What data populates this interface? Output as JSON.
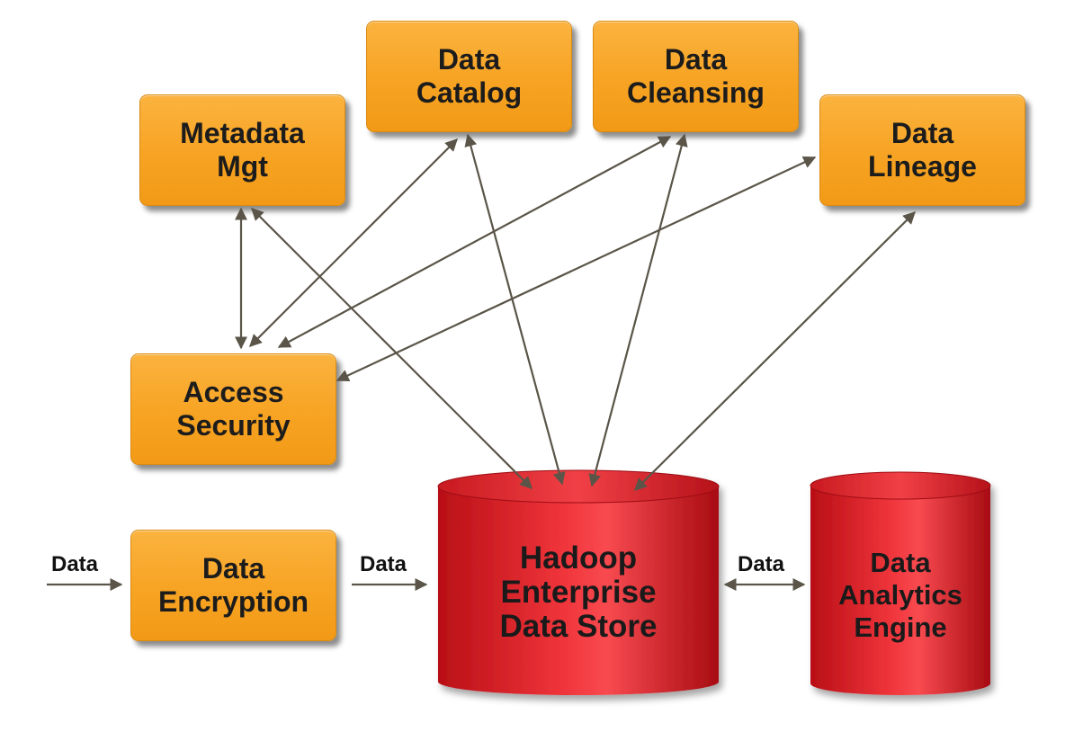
{
  "nodes": {
    "metadata_mgt": "Metadata\nMgt",
    "data_catalog": "Data\nCatalog",
    "data_cleansing": "Data\nCleansing",
    "data_lineage": "Data\nLineage",
    "access_security": "Access\nSecurity",
    "data_encryption": "Data\nEncryption",
    "hadoop_store": "Hadoop\nEnterprise\nData Store",
    "analytics_engine": "Data\nAnalytics\nEngine"
  },
  "flow_labels": {
    "input": "Data",
    "to_store": "Data",
    "store_analytics": "Data"
  },
  "colors": {
    "box_orange": "#f7a323",
    "cylinder_red": "#e82a2f",
    "arrow": "#5a5548"
  }
}
